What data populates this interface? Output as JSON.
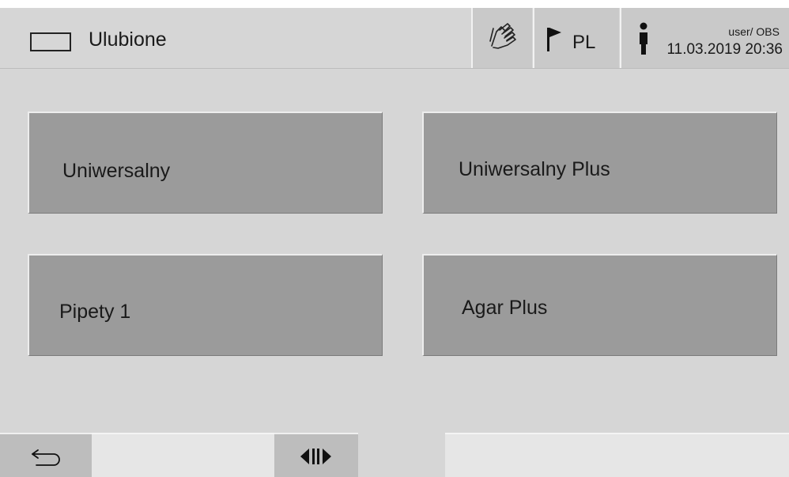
{
  "header": {
    "title": "Ulubione",
    "title_icon": "rectangle-outline-icon",
    "touch_icon": "hand-touch-icon",
    "language": {
      "icon": "flag-icon",
      "label": "PL"
    },
    "user": {
      "icon": "person-icon",
      "label": "user/ OBS",
      "datetime": "11.03.2019  20:36"
    }
  },
  "favourites": [
    {
      "label": "Uniwersalny"
    },
    {
      "label": "Uniwersalny Plus"
    },
    {
      "label": "Pipety 1"
    },
    {
      "label": "Agar Plus"
    }
  ],
  "footer": {
    "back_icon": "back-arrow-icon",
    "toggle_icon": "toggle-left-right-icon"
  }
}
